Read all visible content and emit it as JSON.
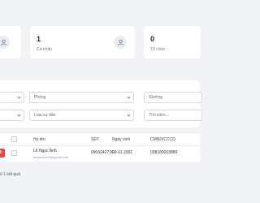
{
  "stats": [
    {
      "count": "",
      "label": ""
    },
    {
      "count": "1",
      "label": "Cá nhân"
    },
    {
      "count": "0",
      "label": "Tổ chức"
    }
  ],
  "filters": {
    "phong": "Phòng",
    "giuong": "Giường",
    "loai_cu_dan": "Loại cư dân",
    "search_placeholder": "Tìm kiếm..."
  },
  "table": {
    "headers": [
      "Họ tên",
      "SĐT",
      "Ngày sinh",
      "CMND/CCCD"
    ],
    "rows": [
      {
        "name": "Lê Ngọc Anh",
        "email": "lengocan15@gmail.com",
        "phone": "0903242716",
        "dob": "09-11-2001",
        "id_number": "038189003889"
      }
    ]
  },
  "result_text": "ố 1 kết quả"
}
